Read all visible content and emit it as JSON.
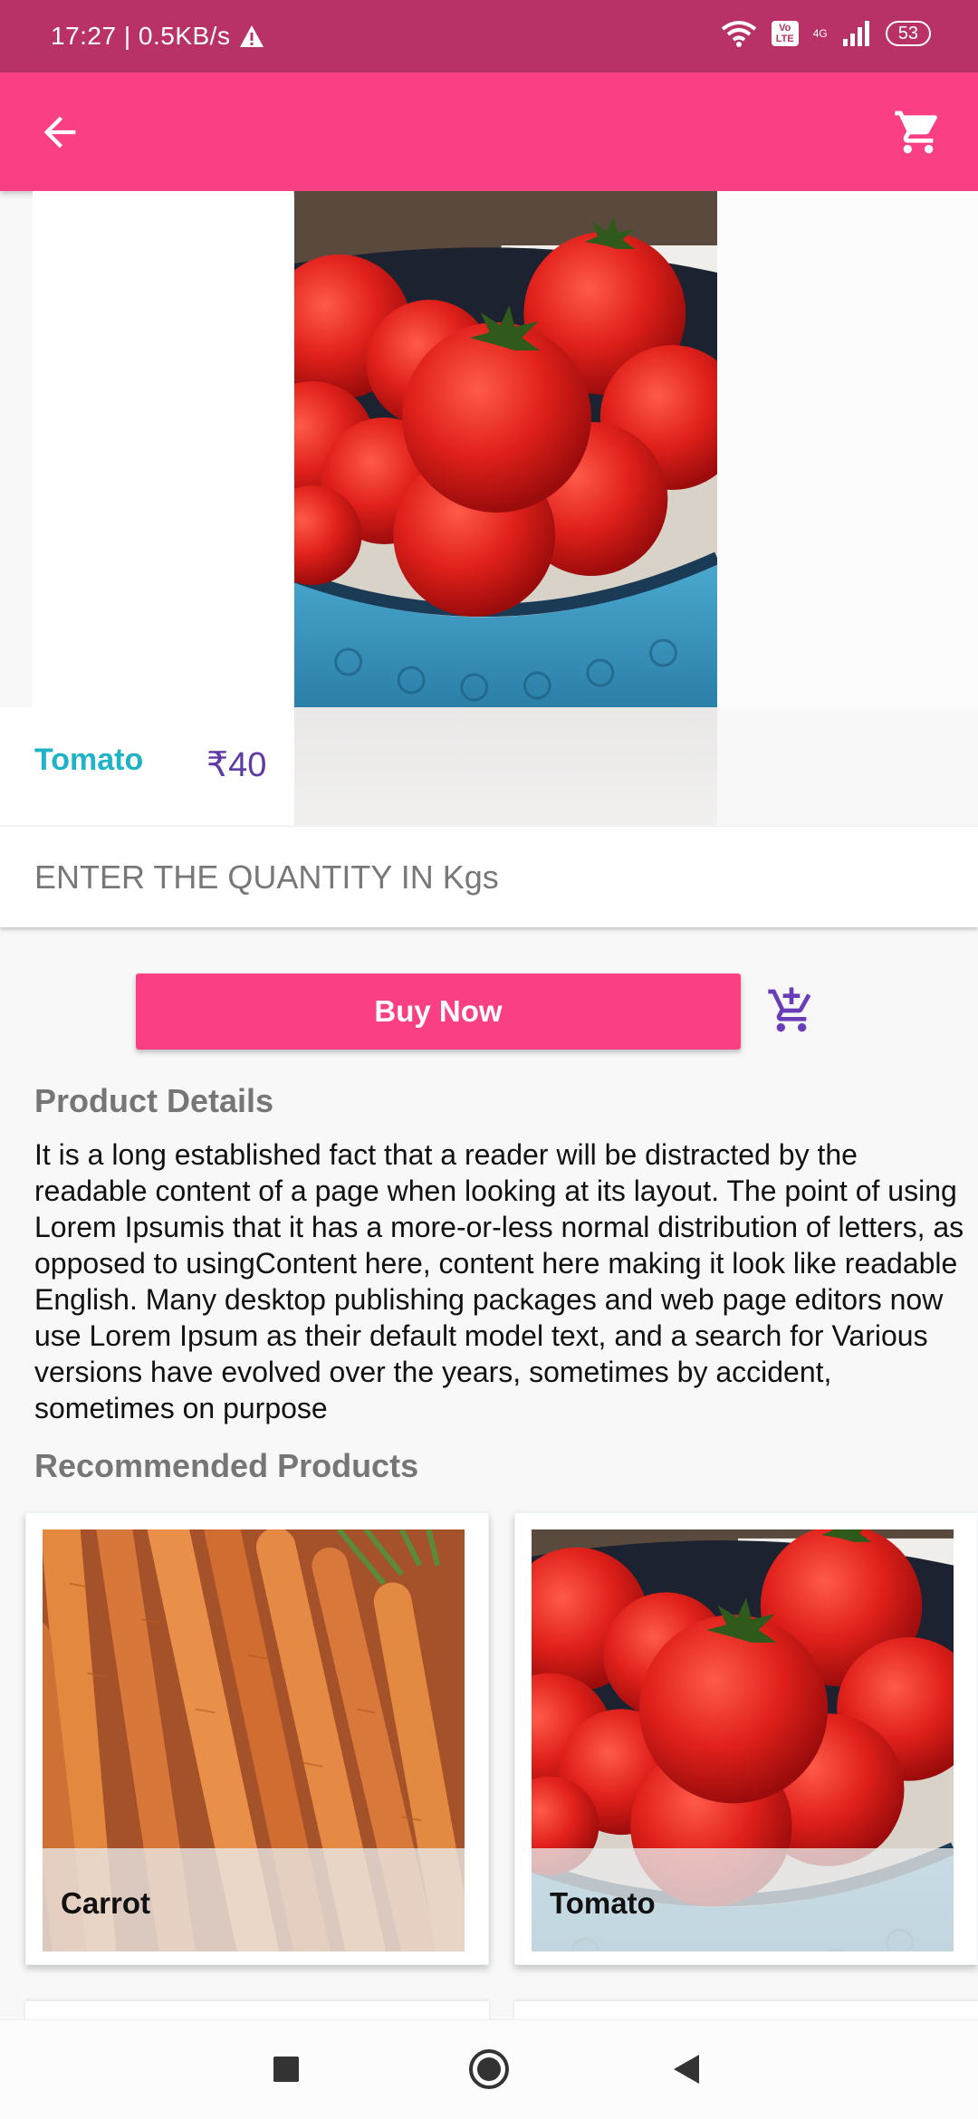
{
  "status_bar": {
    "time_speed": "17:27 | 0.5KB/s",
    "network": "4G",
    "battery": "53",
    "volte_badge": "Vo LTE",
    "icons": [
      "warning-icon",
      "wifi-icon",
      "signal-icon",
      "battery-icon"
    ]
  },
  "app_bar": {
    "back_icon": "arrow-back-icon",
    "cart_icon": "shopping-cart-icon"
  },
  "product": {
    "name": "Tomato",
    "price": "₹40",
    "image": "tomato-bowl-image"
  },
  "quantity": {
    "placeholder": "ENTER THE QUANTITY IN Kgs",
    "value": ""
  },
  "actions": {
    "buy_now_label": "Buy Now",
    "add_to_cart_icon": "add-shopping-cart-icon"
  },
  "details": {
    "title": "Product Details",
    "text": "It is a long established fact that a reader will be distracted by the readable content of a page when looking at its layout. The point of using Lorem Ipsumis that it has a more-or-less normal distribution of letters, as opposed to usingContent here, content here making it look like readable English. Many desktop publishing packages and web page editors now use Lorem Ipsum as their default model text, and a search for Various versions have evolved over the years, sometimes by accident, sometimes on purpose"
  },
  "recommended": {
    "title": "Recommended Products",
    "items": [
      {
        "label": "Carrot",
        "image": "carrot-image"
      },
      {
        "label": "Tomato",
        "image": "tomato-bowl-image"
      }
    ]
  },
  "nav_bar": {
    "icons": [
      "recents-icon",
      "home-icon",
      "back-icon"
    ]
  },
  "colors": {
    "status_bar": "#b83267",
    "accent": "#fb3f84",
    "product_name": "#1fb3c7",
    "price": "#5d3aa5"
  }
}
